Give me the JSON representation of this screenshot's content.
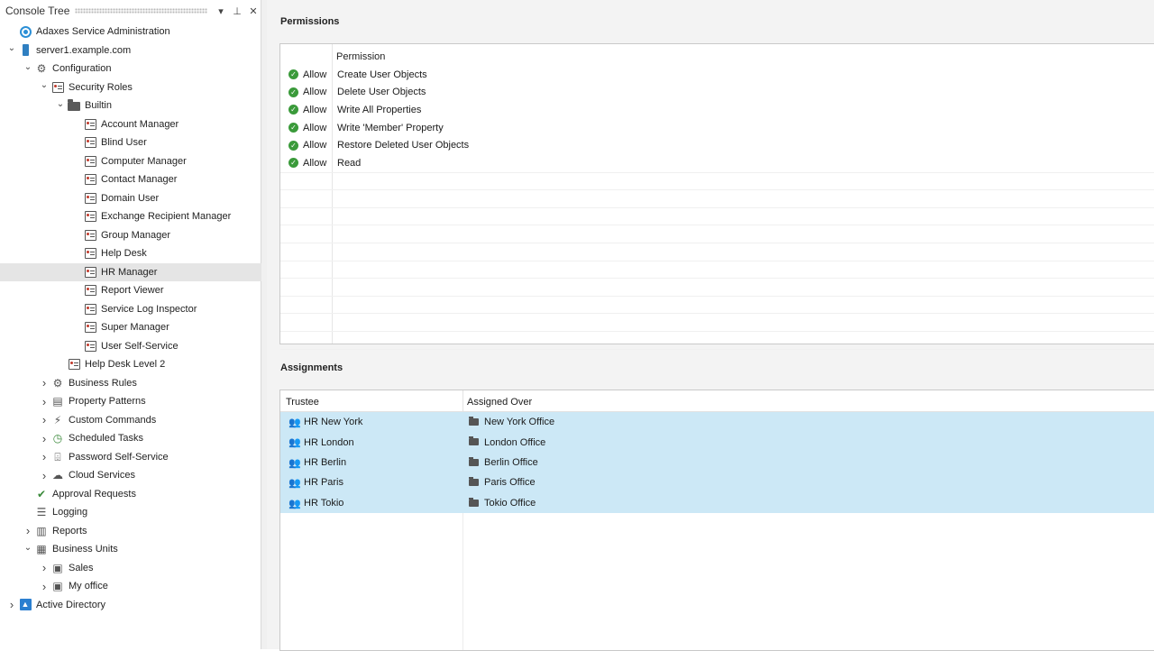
{
  "console_tree": {
    "title": "Console Tree",
    "header_buttons": [
      "▾",
      "⊥",
      "✕"
    ],
    "nodes": [
      {
        "label": "Adaxes Service Administration",
        "level": 0,
        "expander": "",
        "icon": "adaxes-icon",
        "selected": false
      },
      {
        "label": "server1.example.com",
        "level": 0,
        "expander": "expanded",
        "icon": "server-icon",
        "selected": false
      },
      {
        "label": "Configuration",
        "level": 1,
        "expander": "expanded",
        "icon": "configuration-icon",
        "selected": false
      },
      {
        "label": "Security Roles",
        "level": 2,
        "expander": "expanded",
        "icon": "security-roles-icon",
        "selected": false
      },
      {
        "label": "Builtin",
        "level": 3,
        "expander": "expanded",
        "icon": "folder-icon",
        "selected": false
      },
      {
        "label": "Account Manager",
        "level": 4,
        "expander": "",
        "icon": "security-role-icon",
        "selected": false
      },
      {
        "label": "Blind User",
        "level": 4,
        "expander": "",
        "icon": "security-role-icon",
        "selected": false
      },
      {
        "label": "Computer Manager",
        "level": 4,
        "expander": "",
        "icon": "security-role-icon",
        "selected": false
      },
      {
        "label": "Contact Manager",
        "level": 4,
        "expander": "",
        "icon": "security-role-icon",
        "selected": false
      },
      {
        "label": "Domain User",
        "level": 4,
        "expander": "",
        "icon": "security-role-icon",
        "selected": false
      },
      {
        "label": "Exchange Recipient Manager",
        "level": 4,
        "expander": "",
        "icon": "security-role-icon",
        "selected": false
      },
      {
        "label": "Group Manager",
        "level": 4,
        "expander": "",
        "icon": "security-role-icon",
        "selected": false
      },
      {
        "label": "Help Desk",
        "level": 4,
        "expander": "",
        "icon": "security-role-icon",
        "selected": false
      },
      {
        "label": "HR Manager",
        "level": 4,
        "expander": "",
        "icon": "security-role-icon",
        "selected": true
      },
      {
        "label": "Report Viewer",
        "level": 4,
        "expander": "",
        "icon": "security-role-icon",
        "selected": false
      },
      {
        "label": "Service Log Inspector",
        "level": 4,
        "expander": "",
        "icon": "security-role-icon",
        "selected": false
      },
      {
        "label": "Super Manager",
        "level": 4,
        "expander": "",
        "icon": "security-role-icon",
        "selected": false
      },
      {
        "label": "User Self-Service",
        "level": 4,
        "expander": "",
        "icon": "security-role-icon",
        "selected": false
      },
      {
        "label": "Help Desk Level 2",
        "level": 3,
        "expander": "",
        "icon": "security-role-icon",
        "selected": false
      },
      {
        "label": "Business Rules",
        "level": 2,
        "expander": "collapsed",
        "icon": "business-rules-icon",
        "selected": false
      },
      {
        "label": "Property Patterns",
        "level": 2,
        "expander": "collapsed",
        "icon": "property-patterns-icon",
        "selected": false
      },
      {
        "label": "Custom Commands",
        "level": 2,
        "expander": "collapsed",
        "icon": "custom-commands-icon",
        "selected": false
      },
      {
        "label": "Scheduled Tasks",
        "level": 2,
        "expander": "collapsed",
        "icon": "scheduled-tasks-icon",
        "selected": false
      },
      {
        "label": "Password Self-Service",
        "level": 2,
        "expander": "collapsed",
        "icon": "password-self-service-icon",
        "selected": false
      },
      {
        "label": "Cloud Services",
        "level": 2,
        "expander": "collapsed",
        "icon": "cloud-services-icon",
        "selected": false
      },
      {
        "label": "Approval Requests",
        "level": 1,
        "expander": "",
        "icon": "approval-requests-icon",
        "selected": false
      },
      {
        "label": "Logging",
        "level": 1,
        "expander": "",
        "icon": "logging-icon",
        "selected": false
      },
      {
        "label": "Reports",
        "level": 1,
        "expander": "collapsed",
        "icon": "reports-icon",
        "selected": false
      },
      {
        "label": "Business Units",
        "level": 1,
        "expander": "expanded",
        "icon": "business-units-icon",
        "selected": false
      },
      {
        "label": "Sales",
        "level": 2,
        "expander": "collapsed",
        "icon": "business-unit-icon",
        "selected": false
      },
      {
        "label": "My office",
        "level": 2,
        "expander": "collapsed",
        "icon": "business-unit-icon",
        "selected": false
      },
      {
        "label": "Active Directory",
        "level": 0,
        "expander": "collapsed",
        "icon": "active-directory-icon",
        "selected": false
      }
    ]
  },
  "permissions": {
    "title": "Permissions",
    "column_header": "Permission",
    "rows": [
      {
        "type": "Allow",
        "permission": "Create User Objects"
      },
      {
        "type": "Allow",
        "permission": "Delete User Objects"
      },
      {
        "type": "Allow",
        "permission": "Write All Properties"
      },
      {
        "type": "Allow",
        "permission": "Write 'Member' Property"
      },
      {
        "type": "Allow",
        "permission": "Restore Deleted User Objects"
      },
      {
        "type": "Allow",
        "permission": "Read"
      }
    ]
  },
  "assignments": {
    "title": "Assignments",
    "columns": [
      "Trustee",
      "Assigned Over"
    ],
    "rows": [
      {
        "trustee": "HR New York",
        "assigned_over": "New York Office"
      },
      {
        "trustee": "HR London",
        "assigned_over": "London Office"
      },
      {
        "trustee": "HR Berlin",
        "assigned_over": "Berlin Office"
      },
      {
        "trustee": "HR Paris",
        "assigned_over": "Paris Office"
      },
      {
        "trustee": "HR Tokio",
        "assigned_over": "Tokio Office"
      }
    ]
  },
  "colors": {
    "selection_row": "#e5e5e5",
    "assignment_row": "#cce8f6",
    "allow_green": "#3a9a3a",
    "accent_blue": "#2b7fd0"
  }
}
